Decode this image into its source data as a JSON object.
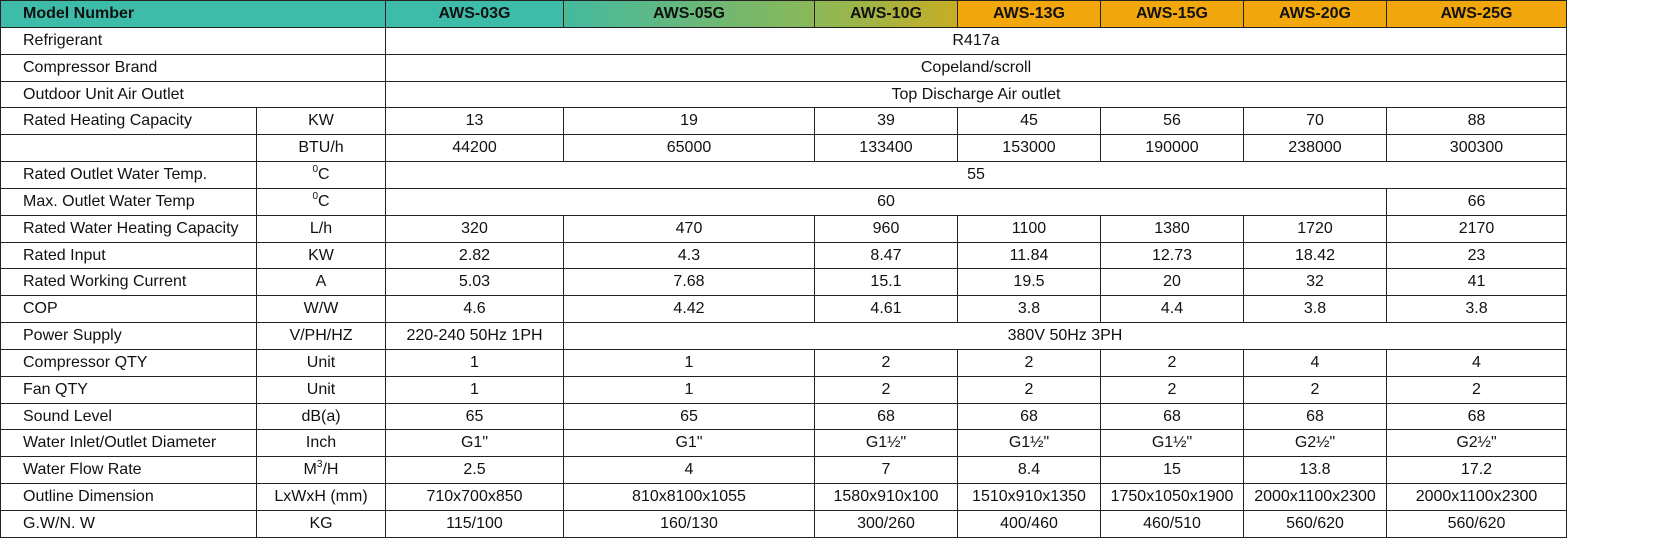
{
  "header": {
    "model_label": "Model Number",
    "models": [
      "AWS-03G",
      "AWS-05G",
      "AWS-10G",
      "AWS-13G",
      "AWS-15G",
      "AWS-20G",
      "AWS-25G"
    ],
    "colors": {
      "teal": "#3dbda9",
      "gradient_start": "#44b99e",
      "gradient_mid": "#8bb858",
      "gradient_end": "#c6ad25",
      "orange": "#f2a70c"
    }
  },
  "rows": {
    "refrigerant": {
      "label": "Refrigerant",
      "value": "R417a"
    },
    "compressor_brand": {
      "label": "Compressor Brand",
      "value": "Copeland/scroll"
    },
    "air_outlet": {
      "label": "Outdoor Unit Air Outlet",
      "value": "Top Discharge Air outlet"
    },
    "heating_capacity": {
      "label": "Rated Heating Capacity",
      "unit_kw": "KW",
      "kw": [
        "13",
        "19",
        "39",
        "45",
        "56",
        "70",
        "88"
      ],
      "unit_btu": "BTU/h",
      "btu": [
        "44200",
        "65000",
        "133400",
        "153000",
        "190000",
        "238000",
        "300300"
      ]
    },
    "outlet_temp": {
      "label": "Rated Outlet Water Temp.",
      "unit_sup": "0",
      "unit_main": "C",
      "value": "55"
    },
    "max_outlet_temp": {
      "label": "Max. Outlet Water Temp",
      "unit_sup": "0",
      "unit_main": "C",
      "value_main": "60",
      "value_last": "66"
    },
    "water_heating_capacity": {
      "label": "Rated Water Heating Capacity",
      "unit": "L/h",
      "values": [
        "320",
        "470",
        "960",
        "1100",
        "1380",
        "1720",
        "2170"
      ]
    },
    "rated_input": {
      "label": "Rated Input",
      "unit": "KW",
      "values": [
        "2.82",
        "4.3",
        "8.47",
        "11.84",
        "12.73",
        "18.42",
        "23"
      ]
    },
    "working_current": {
      "label": "Rated Working Current",
      "unit": "A",
      "values": [
        "5.03",
        "7.68",
        "15.1",
        "19.5",
        "20",
        "32",
        "41"
      ]
    },
    "cop": {
      "label": "COP",
      "unit": "W/W",
      "values": [
        "4.6",
        "4.42",
        "4.61",
        "3.8",
        "4.4",
        "3.8",
        "3.8"
      ]
    },
    "power_supply": {
      "label": "Power Supply",
      "unit": "V/PH/HZ",
      "value_first": "220-240 50Hz 1PH",
      "value_rest": "380V 50Hz 3PH"
    },
    "compressor_qty": {
      "label": "Compressor QTY",
      "unit": "Unit",
      "values": [
        "1",
        "1",
        "2",
        "2",
        "2",
        "4",
        "4"
      ]
    },
    "fan_qty": {
      "label": "Fan QTY",
      "unit": "Unit",
      "values": [
        "1",
        "1",
        "2",
        "2",
        "2",
        "2",
        "2"
      ]
    },
    "sound_level": {
      "label": "Sound Level",
      "unit": "dB(a)",
      "values": [
        "65",
        "65",
        "68",
        "68",
        "68",
        "68",
        "68"
      ]
    },
    "pipe_diameter": {
      "label": "Water Inlet/Outlet Diameter",
      "unit": "Inch",
      "values": [
        "G1\"",
        "G1\"",
        "G1½\"",
        "G1½\"",
        "G1½\"",
        "G2½\"",
        "G2½\""
      ]
    },
    "flow_rate": {
      "label": "Water Flow Rate",
      "unit_main": "M",
      "unit_sup": "3",
      "unit_tail": "/H",
      "values": [
        "2.5",
        "4",
        "7",
        "8.4",
        "15",
        "13.8",
        "17.2"
      ]
    },
    "dimension": {
      "label": "Outline Dimension",
      "unit": "LxWxH (mm)",
      "values": [
        "710x700x850",
        "810x8100x1055",
        "1580x910x100",
        "1510x910x1350",
        "1750x1050x1900",
        "2000x1100x2300",
        "2000x1100x2300"
      ]
    },
    "weight": {
      "label": "G.W/N. W",
      "unit": "KG",
      "values": [
        "115/100",
        "160/130",
        "300/260",
        "400/460",
        "460/510",
        "560/620",
        "560/620"
      ]
    }
  }
}
